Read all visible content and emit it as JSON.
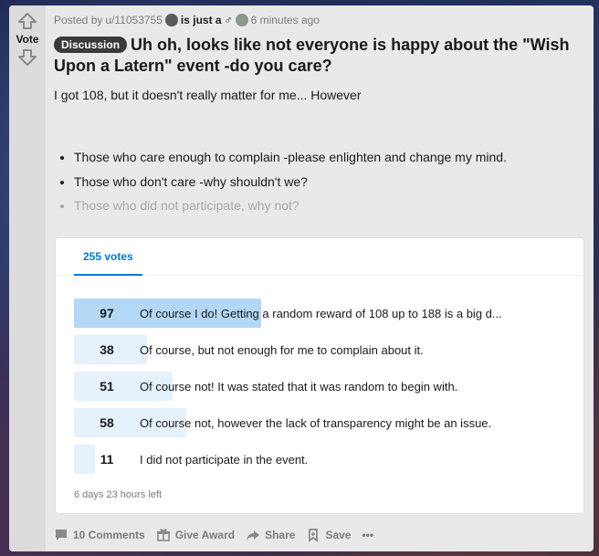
{
  "vote": {
    "label": "Vote"
  },
  "post": {
    "prefix": "Posted by",
    "author": "u/11053755",
    "flair": "is just a",
    "time": "6 minutes ago",
    "tag": "Discussion",
    "title": "Uh oh, looks like not everyone is happy about the \"Wish Upon a Latern\" event -do you care?",
    "body": "I got 108, but it doesn't really matter for me... However",
    "bullets": [
      "Those who care enough to complain -please enlighten and change my mind.",
      "Those who don't care -why shouldn't we?",
      "Those who did not participate, why not?"
    ]
  },
  "poll": {
    "tab_label": "255 votes",
    "total": 255,
    "options": [
      {
        "count": "97",
        "value": 97,
        "label": "Of course I do! Getting a random reward of 108 up to 188 is a big d..."
      },
      {
        "count": "38",
        "value": 38,
        "label": "Of course, but not enough for me to complain about it."
      },
      {
        "count": "51",
        "value": 51,
        "label": "Of course not! It was stated that it was random to begin with."
      },
      {
        "count": "58",
        "value": 58,
        "label": "Of course not, however the lack of transparency might be an issue."
      },
      {
        "count": "11",
        "value": 11,
        "label": "I did not participate in the event."
      }
    ],
    "time_left": "6 days 23 hours left"
  },
  "actions": {
    "comments": "10 Comments",
    "award": "Give Award",
    "share": "Share",
    "save": "Save",
    "more": "•••"
  },
  "colors": {
    "accent": "#0079d3",
    "bar_top": "#b3d8f5",
    "bar": "#e5f1fb"
  }
}
